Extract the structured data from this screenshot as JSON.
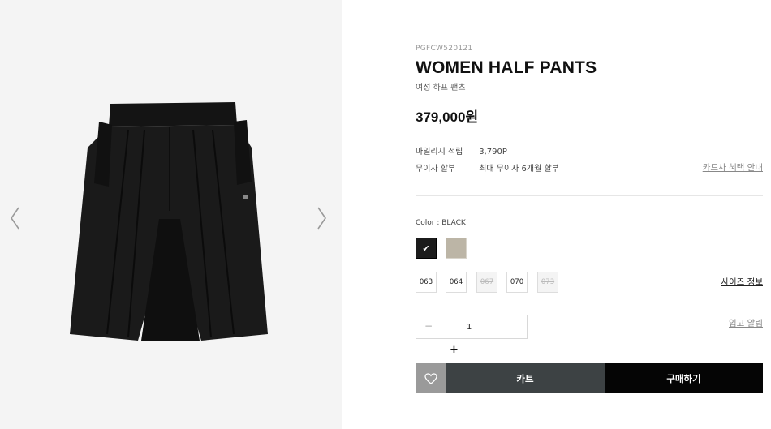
{
  "product": {
    "code": "PGFCW520121",
    "name": "WOMEN HALF PANTS",
    "name_kr": "여성 하프 팬츠",
    "price": "379,000원",
    "image_icon": "black-shorts-image"
  },
  "meta": {
    "mileage_label": "마일리지 적립",
    "mileage_value": "3,790P",
    "installment_label": "무이자 할부",
    "installment_value": "최대 무이자 6개월 할부",
    "card_benefit_link": "카드사 혜택 안내"
  },
  "color": {
    "label": "Color : BLACK",
    "selected_mark": "✔",
    "swatches": [
      {
        "name": "black",
        "hex": "#1b1b1b",
        "selected": true
      },
      {
        "name": "beige",
        "hex": "#bcb5a6",
        "selected": false
      }
    ]
  },
  "sizes": [
    {
      "label": "063",
      "available": true
    },
    {
      "label": "064",
      "available": true
    },
    {
      "label": "067",
      "available": false
    },
    {
      "label": "070",
      "available": true
    },
    {
      "label": "073",
      "available": false
    }
  ],
  "size_info_link": "사이즈 정보",
  "quantity": {
    "minus": "−",
    "value": "1",
    "plus": "+"
  },
  "restock_link": "입고 알림",
  "actions": {
    "wish_icon": "heart-icon",
    "cart_label": "카트",
    "buy_label": "구매하기"
  },
  "colors": {
    "cart_bg": "#3d4244",
    "buy_bg": "#050505",
    "wish_bg": "#9a9a9a",
    "gallery_bg": "#f4f4f4"
  }
}
